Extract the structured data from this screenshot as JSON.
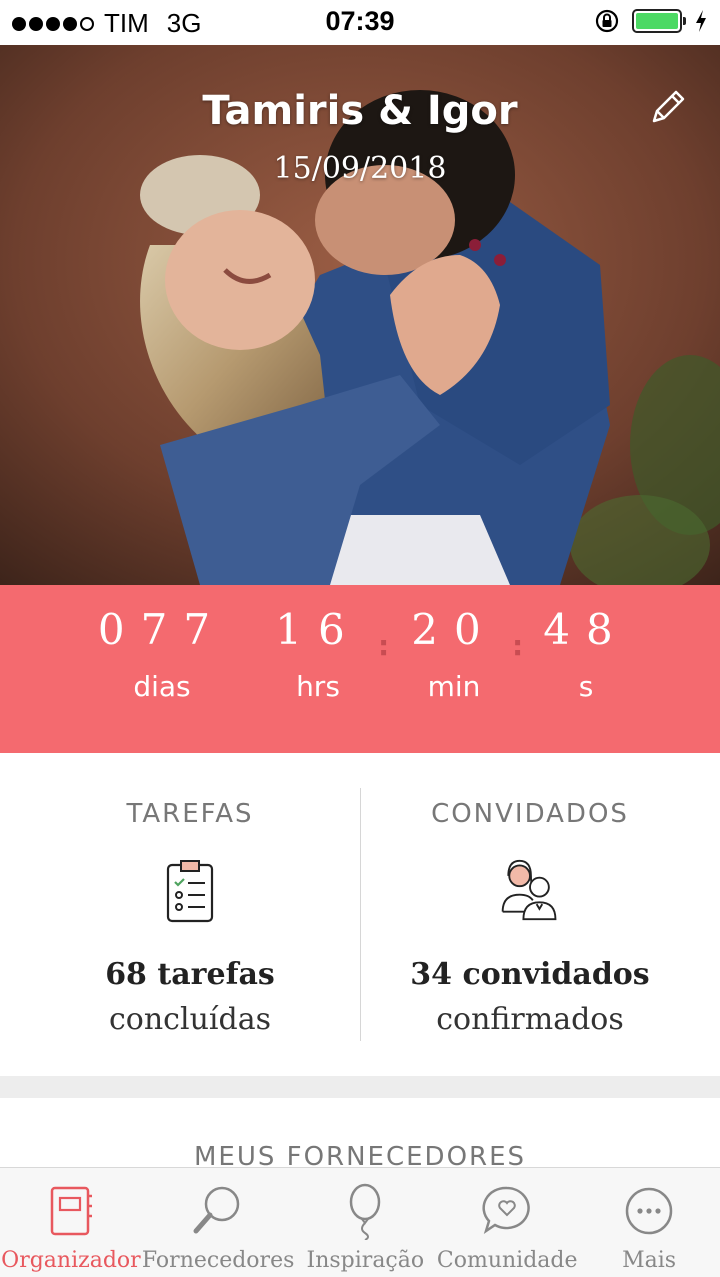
{
  "status_bar": {
    "carrier": "TIM",
    "network": "3G",
    "time": "07:39"
  },
  "hero": {
    "couple_names": "Tamiris & Igor",
    "wedding_date": "15/09/2018"
  },
  "countdown": {
    "days": "077",
    "hours": "16",
    "minutes": "20",
    "seconds": "48",
    "days_label": "dias",
    "hours_label": "hrs",
    "minutes_label": "min",
    "seconds_label": "s"
  },
  "stats": {
    "tasks": {
      "title": "TAREFAS",
      "main": "68 tarefas",
      "sub": "concluídas"
    },
    "guests": {
      "title": "CONVIDADOS",
      "main": "34 convidados",
      "sub": "confirmados"
    }
  },
  "vendors": {
    "title": "MEUS FORNECEDORES"
  },
  "tabbar": {
    "items": [
      {
        "label": "Organizador",
        "icon": "planner-icon"
      },
      {
        "label": "Fornecedores",
        "icon": "search-icon"
      },
      {
        "label": "Inspiração",
        "icon": "balloon-icon"
      },
      {
        "label": "Comunidade",
        "icon": "chat-heart-icon"
      },
      {
        "label": "Mais",
        "icon": "more-icon"
      }
    ]
  },
  "colors": {
    "accent": "#f46a6f",
    "active_tab": "#e8585e",
    "battery": "#4cd964"
  }
}
